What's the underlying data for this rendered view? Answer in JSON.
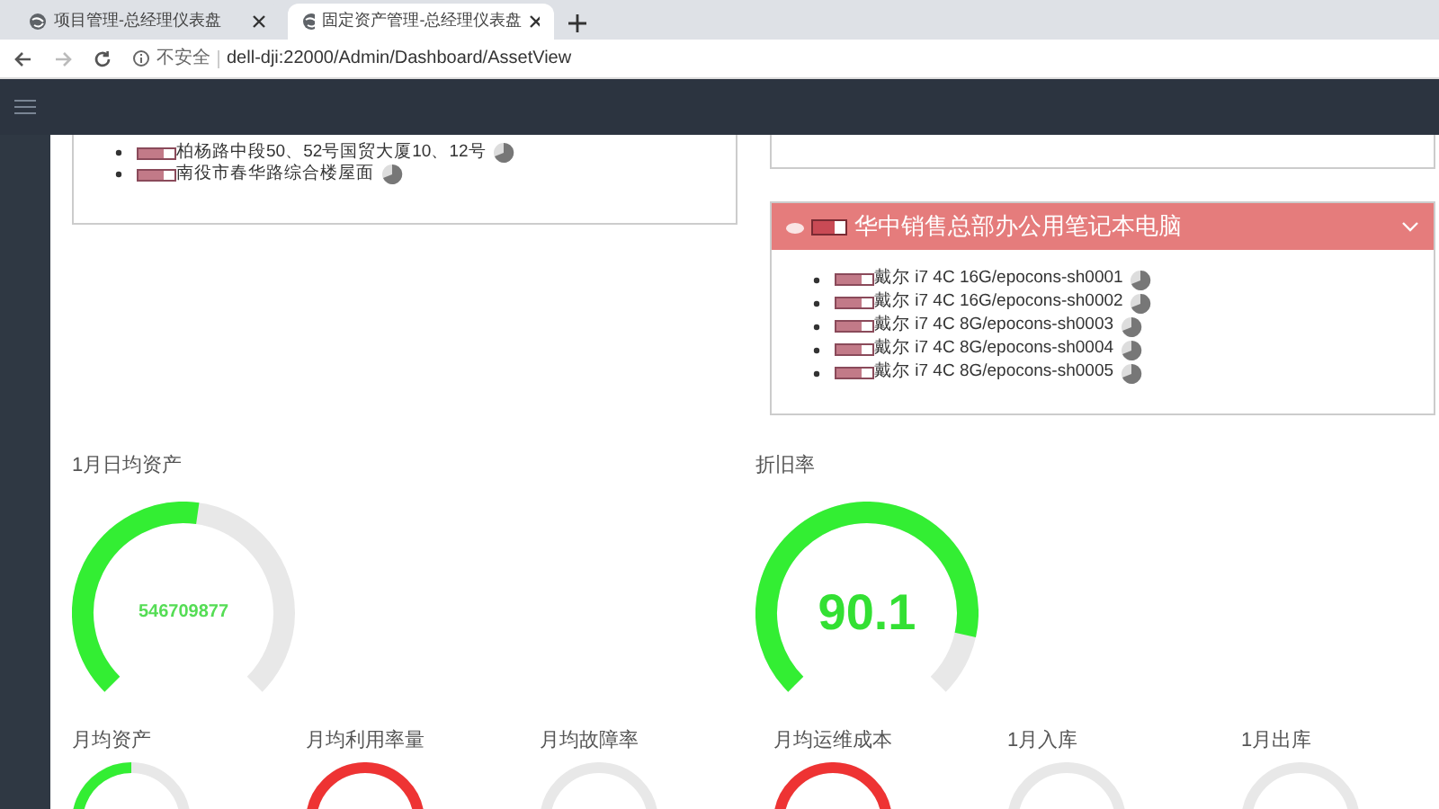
{
  "browser": {
    "tabs": [
      {
        "title": "项目管理-总经理仪表盘",
        "selected": false
      },
      {
        "title": "固定资产管理-总经理仪表盘",
        "selected": true
      }
    ],
    "address": {
      "security": "不安全",
      "url": "dell-dji:22000/Admin/Dashboard/AssetView"
    }
  },
  "left_card": {
    "items": [
      "柏杨路中段50、52号国贸大厦10、12号",
      "南役市春华路综合楼屋面"
    ]
  },
  "right_card": {
    "title": "华中销售总部办公用笔记本电脑",
    "expanded": true,
    "items": [
      "戴尔 i7 4C 16G/epocons-sh0001",
      "戴尔 i7 4C 16G/epocons-sh0002",
      "戴尔 i7 4C 8G/epocons-sh0003",
      "戴尔 i7 4C 8G/epocons-sh0004",
      "戴尔 i7 4C 8G/epocons-sh0005"
    ]
  },
  "big_gauges": [
    {
      "label": "1月日均资产",
      "value": "546709877",
      "level": 0.53,
      "color": "#33ee33"
    },
    {
      "label": "折旧率",
      "value": "90.1",
      "level": 0.88,
      "color": "#33ee33"
    }
  ],
  "small_gauges": [
    {
      "label": "月均资产",
      "level": 0.5,
      "color": "#33ee33"
    },
    {
      "label": "月均利用率量",
      "level": 1,
      "color": "#ee3333"
    },
    {
      "label": "月均故障率"
    },
    {
      "label": "月均运维成本",
      "level": 1,
      "color": "#ee3333"
    },
    {
      "label": "1月入库"
    },
    {
      "label": "1月出库"
    }
  ]
}
